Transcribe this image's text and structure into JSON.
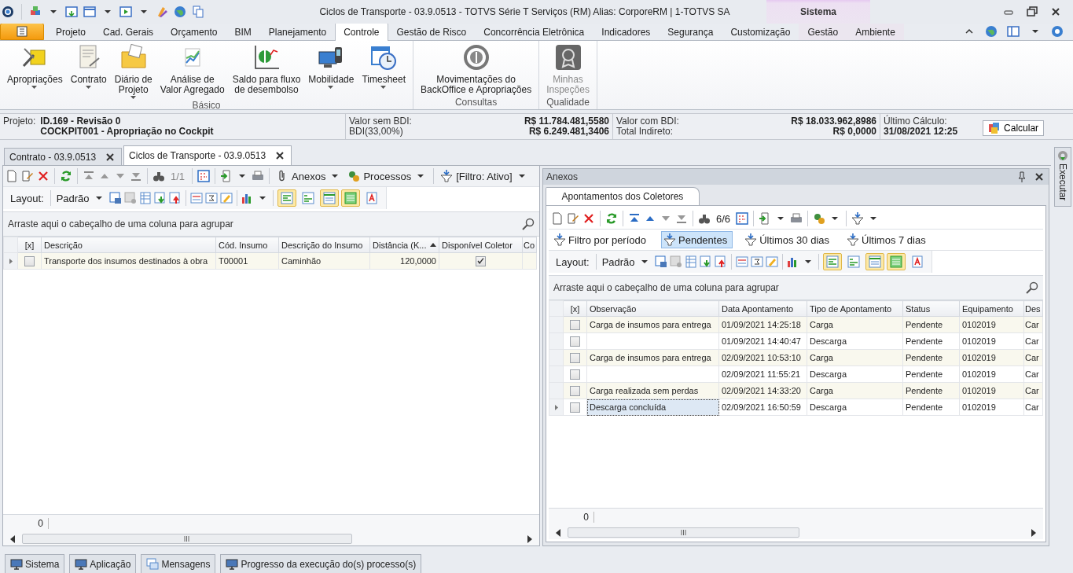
{
  "window": {
    "title": "Ciclos de Transporte - 03.9.0513 - TOTVS Série T Serviços (RM) Alias: CorporeRM | 1-TOTVS SA",
    "context_tab": "Sistema"
  },
  "ribbon_tabs": [
    {
      "label": "Projeto",
      "selected": false
    },
    {
      "label": "Cad. Gerais",
      "selected": false
    },
    {
      "label": "Orçamento",
      "selected": false
    },
    {
      "label": "BIM",
      "selected": false
    },
    {
      "label": "Planejamento",
      "selected": false
    },
    {
      "label": "Controle",
      "selected": true
    },
    {
      "label": "Gestão de Risco",
      "selected": false
    },
    {
      "label": "Concorrência Eletrônica",
      "selected": false
    },
    {
      "label": "Indicadores",
      "selected": false
    },
    {
      "label": "Segurança",
      "selected": false
    },
    {
      "label": "Customização",
      "selected": false
    },
    {
      "label": "Gestão",
      "selected": false,
      "kind": "context"
    },
    {
      "label": "Ambiente",
      "selected": false,
      "kind": "context"
    }
  ],
  "ribbon_groups": [
    {
      "name": "Básico",
      "buttons": [
        {
          "label": "Apropriações",
          "dropdown": true,
          "disabled": false
        },
        {
          "label": "Contrato",
          "dropdown": true,
          "disabled": false
        },
        {
          "label": "Diário de\nProjeto",
          "dropdown": true,
          "disabled": false
        },
        {
          "label": "Análise de\nValor Agregado",
          "dropdown": false,
          "disabled": false
        },
        {
          "label": "Saldo para fluxo\nde desembolso",
          "dropdown": false,
          "disabled": false
        },
        {
          "label": "Mobilidade",
          "dropdown": true,
          "disabled": false
        },
        {
          "label": "Timesheet",
          "dropdown": true,
          "disabled": false
        }
      ]
    },
    {
      "name": "Consultas",
      "buttons": [
        {
          "label": "Movimentações do\nBackOffice e Apropriações",
          "dropdown": false,
          "disabled": false
        }
      ]
    },
    {
      "name": "Qualidade",
      "buttons": [
        {
          "label": "Minhas\nInspeções",
          "dropdown": false,
          "disabled": true
        }
      ]
    }
  ],
  "project_bar": {
    "label": "Projeto:",
    "id": "ID.169 - Revisão 0",
    "name": "COCKPIT001 - Apropriação no Cockpit",
    "values": [
      {
        "label": "Valor sem BDI:",
        "value": "R$ 11.784.481,5580"
      },
      {
        "label": "BDI(33,00%)",
        "value": "R$ 6.249.481,3406"
      },
      {
        "label": "Valor com BDI:",
        "value": "R$ 18.033.962,8986"
      },
      {
        "label": "Total Indireto:",
        "value": "R$ 0,0000"
      }
    ],
    "last_calc_label": "Último Cálculo:",
    "last_calc": "31/08/2021 12:25",
    "button": "Calcular"
  },
  "document_tabs": [
    {
      "label": "Contrato - 03.9.0513",
      "selected": false
    },
    {
      "label": "Ciclos de Transporte - 03.9.0513",
      "selected": true
    }
  ],
  "left_panel": {
    "toolbar": {
      "counter": "1/1",
      "attachments": "Anexos",
      "processes": "Processos",
      "filter": "[Filtro: Ativo]"
    },
    "layout_bar": {
      "label": "Layout:",
      "preset": "Padrão",
      "toggles": [
        {
          "on": true
        },
        {
          "on": false
        },
        {
          "on": true
        },
        {
          "on": true
        },
        {
          "on": false
        }
      ]
    },
    "group_hint": "Arraste aqui o cabeçalho de uma coluna para agrupar",
    "check_column": "[x]",
    "columns": [
      "Descrição",
      "Cód. Insumo",
      "Descrição do Insumo",
      "Distância (K...",
      "Disponível Coletor",
      "Co"
    ],
    "rows": [
      {
        "checked": false,
        "current": true,
        "cells": [
          "Transporte dos insumos destinados à obra",
          "T00001",
          "Caminhão",
          "120,0000"
        ],
        "available": true
      }
    ],
    "footer": "0"
  },
  "anexos_panel": {
    "title": "Anexos",
    "tab": "Apontamentos dos Coletores",
    "toolbar": {
      "counter": "6/6"
    },
    "filters": [
      {
        "label": "Filtro por período",
        "selected": false
      },
      {
        "label": "Pendentes",
        "selected": true
      },
      {
        "label": "Últimos 30 dias",
        "selected": false
      },
      {
        "label": "Últimos 7 dias",
        "selected": false
      }
    ],
    "layout_bar": {
      "label": "Layout:",
      "preset": "Padrão",
      "toggles": [
        {
          "on": true
        },
        {
          "on": false
        },
        {
          "on": true
        },
        {
          "on": true
        },
        {
          "on": false
        }
      ]
    },
    "group_hint": "Arraste aqui o cabeçalho de uma coluna para agrupar",
    "check_column": "[x]",
    "columns": [
      "Observação",
      "Data Apontamento",
      "Tipo de Apontamento",
      "Status",
      "Equipamento",
      "Des"
    ],
    "rows": [
      {
        "checked": false,
        "current": false,
        "cells": [
          "Carga de insumos para entrega",
          "01/09/2021 14:25:18",
          "Carga",
          "Pendente",
          "0102019",
          "Car"
        ]
      },
      {
        "checked": false,
        "current": false,
        "cells": [
          "",
          "01/09/2021 14:40:47",
          "Descarga",
          "Pendente",
          "0102019",
          "Car"
        ]
      },
      {
        "checked": false,
        "current": false,
        "cells": [
          "Carga de insumos para entrega",
          "02/09/2021 10:53:10",
          "Carga",
          "Pendente",
          "0102019",
          "Car"
        ]
      },
      {
        "checked": false,
        "current": false,
        "cells": [
          "",
          "02/09/2021 11:55:21",
          "Descarga",
          "Pendente",
          "0102019",
          "Car"
        ]
      },
      {
        "checked": false,
        "current": false,
        "cells": [
          "Carga realizada sem perdas",
          "02/09/2021 14:33:20",
          "Carga",
          "Pendente",
          "0102019",
          "Car"
        ]
      },
      {
        "checked": false,
        "current": true,
        "cells": [
          "Descarga concluída",
          "02/09/2021 16:50:59",
          "Descarga",
          "Pendente",
          "0102019",
          "Car"
        ]
      }
    ],
    "footer": "0"
  },
  "side_tab": "Executar",
  "bottom_tabs": [
    "Sistema",
    "Aplicação",
    "Mensagens",
    "Progresso da execução do(s) processo(s)"
  ]
}
